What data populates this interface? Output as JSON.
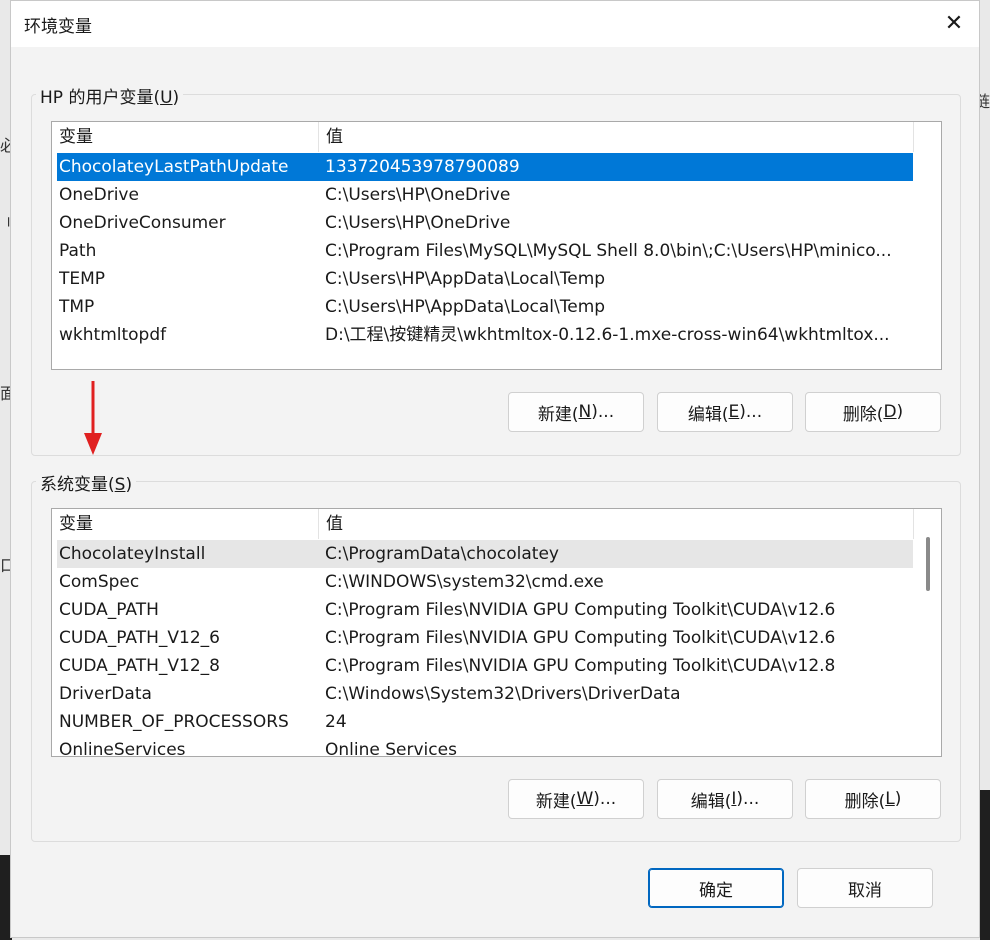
{
  "dialog": {
    "title": "环境变量",
    "close_glyph": "✕"
  },
  "user_vars": {
    "label_prefix": "HP 的用户变量(",
    "label_key": "U",
    "label_suffix": ")",
    "columns": [
      "变量",
      "值"
    ],
    "rows": [
      {
        "name": "ChocolateyLastPathUpdate",
        "value": "133720453978790089"
      },
      {
        "name": "OneDrive",
        "value": "C:\\Users\\HP\\OneDrive"
      },
      {
        "name": "OneDriveConsumer",
        "value": "C:\\Users\\HP\\OneDrive"
      },
      {
        "name": "Path",
        "value": "C:\\Program Files\\MySQL\\MySQL Shell 8.0\\bin\\;C:\\Users\\HP\\minico..."
      },
      {
        "name": "TEMP",
        "value": "C:\\Users\\HP\\AppData\\Local\\Temp"
      },
      {
        "name": "TMP",
        "value": "C:\\Users\\HP\\AppData\\Local\\Temp"
      },
      {
        "name": "wkhtmltopdf",
        "value": "D:\\工程\\按键精灵\\wkhtmltox-0.12.6-1.mxe-cross-win64\\wkhtmltox..."
      }
    ],
    "buttons": {
      "new": {
        "prefix": "新建(",
        "key": "N",
        "suffix": ")..."
      },
      "edit": {
        "prefix": "编辑(",
        "key": "E",
        "suffix": ")..."
      },
      "delete": {
        "prefix": "删除(",
        "key": "D",
        "suffix": ")"
      }
    }
  },
  "system_vars": {
    "label_prefix": "系统变量(",
    "label_key": "S",
    "label_suffix": ")",
    "columns": [
      "变量",
      "值"
    ],
    "rows": [
      {
        "name": "ChocolateyInstall",
        "value": "C:\\ProgramData\\chocolatey"
      },
      {
        "name": "ComSpec",
        "value": "C:\\WINDOWS\\system32\\cmd.exe"
      },
      {
        "name": "CUDA_PATH",
        "value": "C:\\Program Files\\NVIDIA GPU Computing Toolkit\\CUDA\\v12.6"
      },
      {
        "name": "CUDA_PATH_V12_6",
        "value": "C:\\Program Files\\NVIDIA GPU Computing Toolkit\\CUDA\\v12.6"
      },
      {
        "name": "CUDA_PATH_V12_8",
        "value": "C:\\Program Files\\NVIDIA GPU Computing Toolkit\\CUDA\\v12.8"
      },
      {
        "name": "DriverData",
        "value": "C:\\Windows\\System32\\Drivers\\DriverData"
      },
      {
        "name": "NUMBER_OF_PROCESSORS",
        "value": "24"
      },
      {
        "name": "OnlineServices",
        "value": "Online Services"
      }
    ],
    "buttons": {
      "new": {
        "prefix": "新建(",
        "key": "W",
        "suffix": ")..."
      },
      "edit": {
        "prefix": "编辑(",
        "key": "I",
        "suffix": ")..."
      },
      "delete": {
        "prefix": "删除(",
        "key": "L",
        "suffix": ")"
      }
    }
  },
  "footer": {
    "ok": "确定",
    "cancel": "取消"
  },
  "background": {
    "left_fragments": [
      "必",
      "刂",
      "面",
      "口"
    ],
    "right_fragment": "链"
  },
  "colors": {
    "selection": "#0078d7",
    "arrow": "#e02020"
  }
}
